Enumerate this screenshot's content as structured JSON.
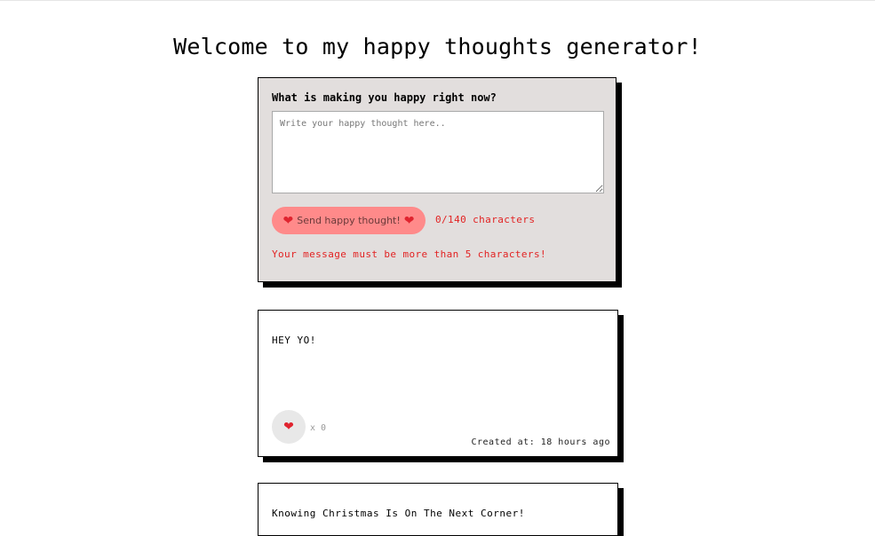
{
  "page": {
    "title": "Welcome to my happy thoughts generator!"
  },
  "form": {
    "label": "What is making you happy right now?",
    "input_placeholder": "Write your happy thought here..",
    "input_value": "",
    "button_heart_left": "❤",
    "button_label": "Send happy thought!",
    "button_heart_right": "❤",
    "char_count": "0/140 characters",
    "error": "Your message must be more than 5 characters!"
  },
  "thoughts": [
    {
      "message": "HEY YO!",
      "heart": "❤",
      "likes": "x 0",
      "created": "Created at: 18 hours ago"
    },
    {
      "message": "Knowing Christmas Is On The Next Corner!"
    }
  ],
  "colors": {
    "card_bg": "#e2dedd",
    "button_bg": "#ff8a8a",
    "error_text": "#e22222",
    "heart": "#e0242f"
  },
  "icons": {
    "heart": "heart-icon"
  }
}
